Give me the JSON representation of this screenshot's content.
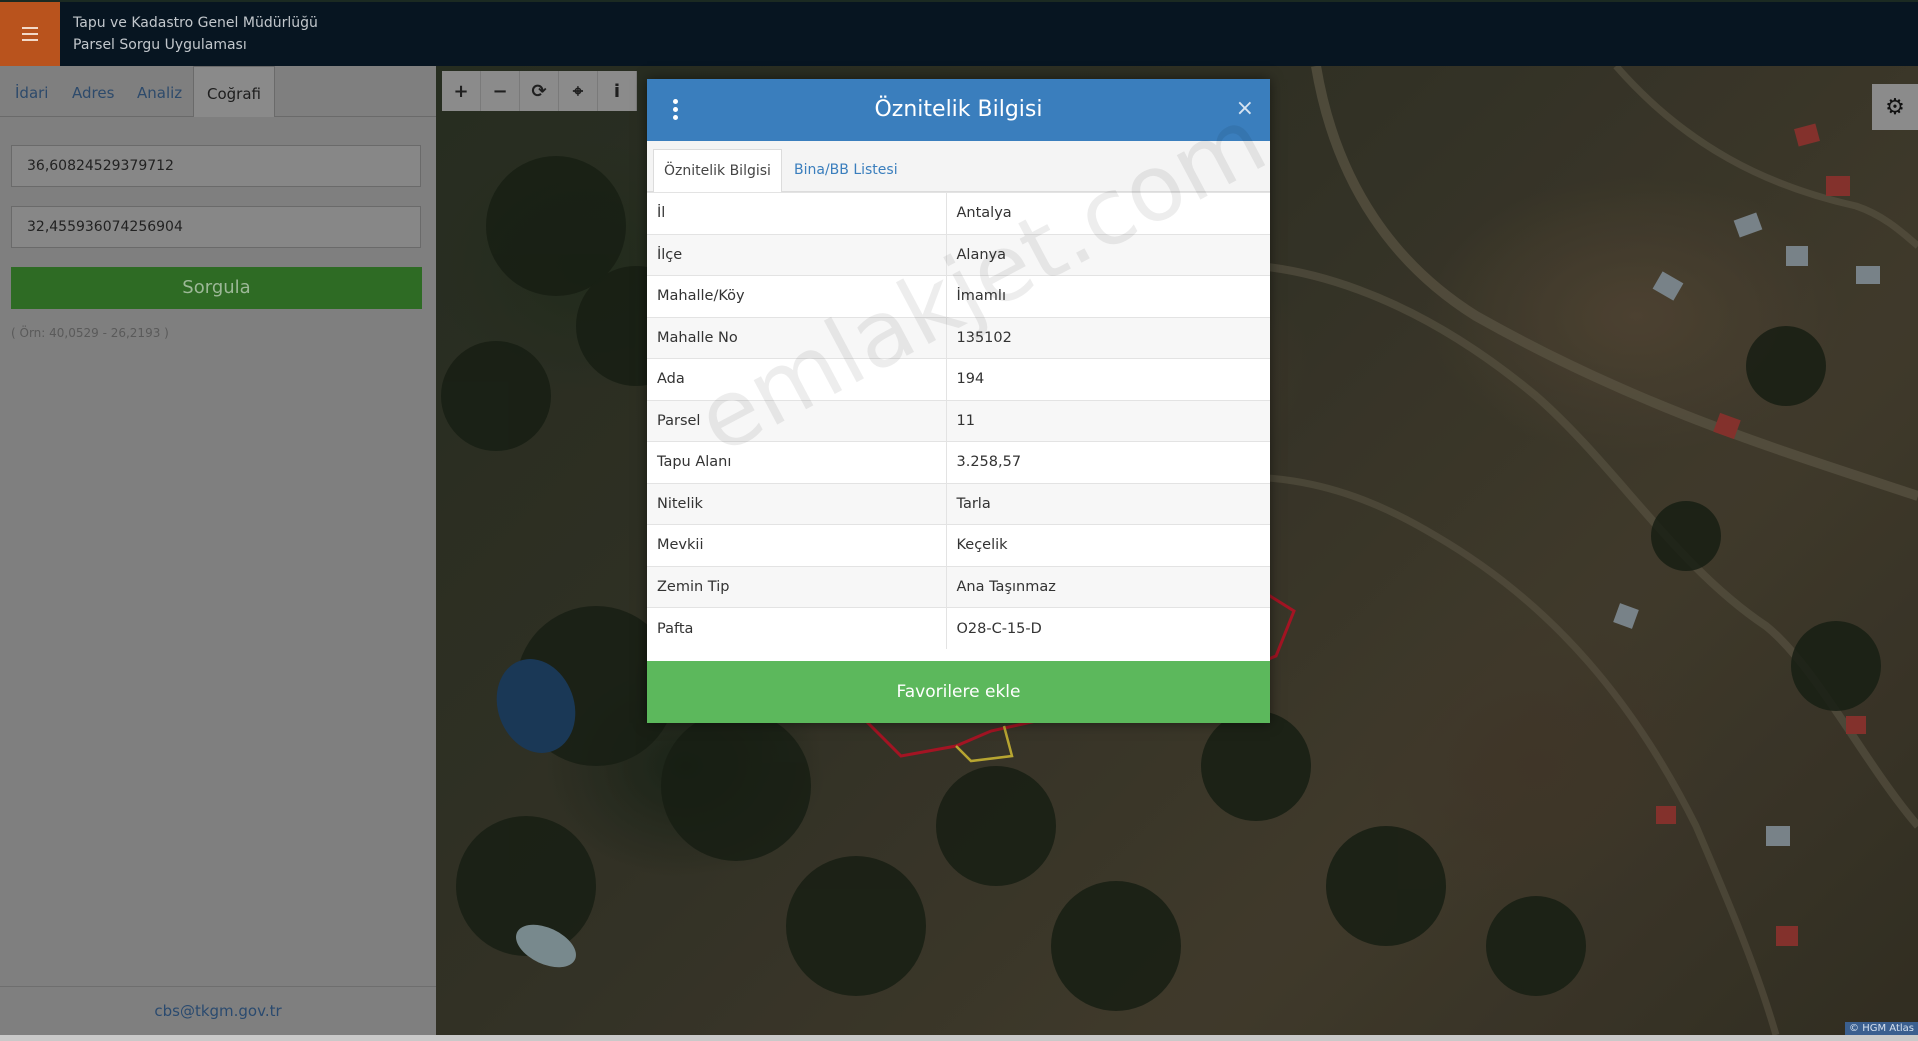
{
  "header": {
    "title_line1": "Tapu ve Kadastro Genel Müdürlüğü",
    "title_line2": "Parsel Sorgu Uygulaması"
  },
  "sidebar": {
    "tabs": [
      {
        "label": "İdari"
      },
      {
        "label": "Adres"
      },
      {
        "label": "Analiz"
      },
      {
        "label": "Coğrafi"
      }
    ],
    "active_tab": "Coğrafi",
    "latitude_value": "36,60824529379712",
    "longitude_value": "32,455936074256904",
    "query_button": "Sorgula",
    "hint": "( Örn: 40,0529 - 26,2193 )",
    "footer_email": "cbs@tkgm.gov.tr"
  },
  "map": {
    "toolbar": [
      {
        "icon": "plus-icon",
        "glyph": "+"
      },
      {
        "icon": "minus-icon",
        "glyph": "−"
      },
      {
        "icon": "refresh-icon",
        "glyph": "⟳"
      },
      {
        "icon": "crosshair-icon",
        "glyph": "⌖"
      },
      {
        "icon": "info-icon",
        "glyph": "i"
      }
    ],
    "settings_icon": "⚙",
    "attribution": "© HGM Atlas"
  },
  "modal": {
    "title": "Öznitelik Bilgisi",
    "close_glyph": "×",
    "tabs": [
      {
        "label": "Öznitelik Bilgisi"
      },
      {
        "label": "Bina/BB Listesi"
      }
    ],
    "rows": [
      {
        "key": "İl",
        "value": "Antalya"
      },
      {
        "key": "İlçe",
        "value": "Alanya"
      },
      {
        "key": "Mahalle/Köy",
        "value": "İmamlı"
      },
      {
        "key": "Mahalle No",
        "value": "135102"
      },
      {
        "key": "Ada",
        "value": "194"
      },
      {
        "key": "Parsel",
        "value": "11"
      },
      {
        "key": "Tapu Alanı",
        "value": "3.258,57"
      },
      {
        "key": "Nitelik",
        "value": "Tarla"
      },
      {
        "key": "Mevkii",
        "value": "Keçelik"
      },
      {
        "key": "Zemin Tip",
        "value": "Ana Taşınmaz"
      },
      {
        "key": "Pafta",
        "value": "O28-C-15-D"
      }
    ],
    "favorite_button": "Favorilere ekle"
  },
  "watermark": "emlakjet.com",
  "colors": {
    "header_bg": "#071521",
    "menu_accent": "#b9531d",
    "modal_header": "#3a7ebd",
    "favorite_green": "#5cb85c",
    "query_green": "#2e6b24",
    "parcel_red": "#c0182a",
    "parcel_yellow": "#d8c23a"
  }
}
